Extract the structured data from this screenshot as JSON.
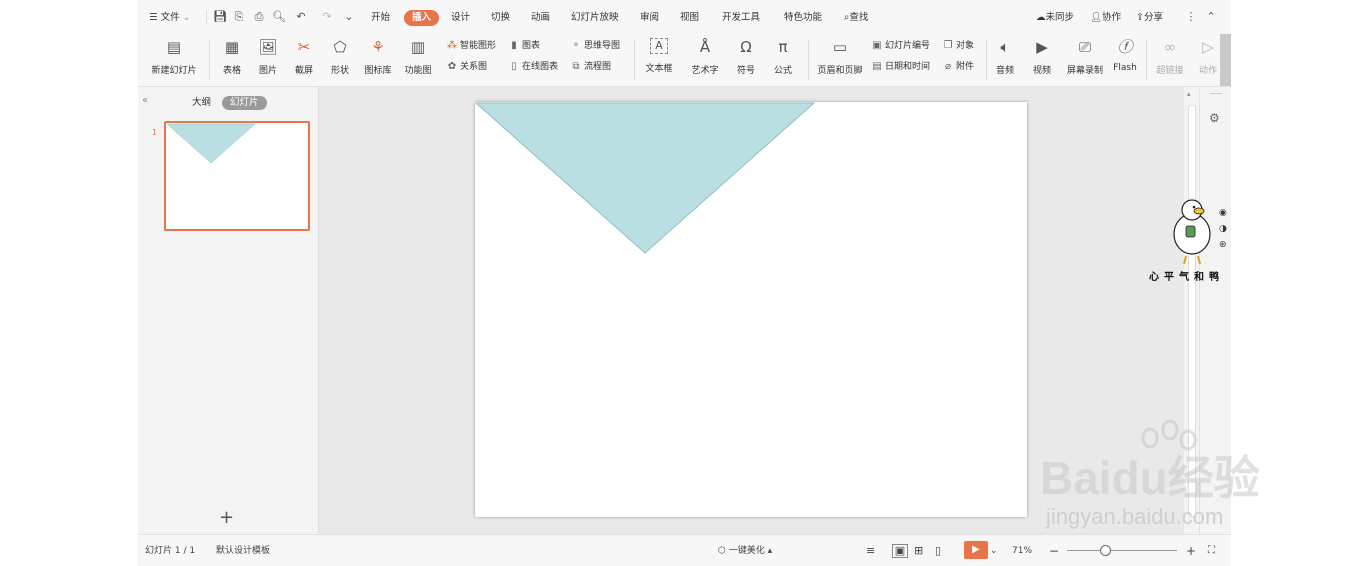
{
  "menubar": {
    "file_label": "文件",
    "tabs": [
      "开始",
      "插入",
      "设计",
      "切换",
      "动画",
      "幻灯片放映",
      "审阅",
      "视图",
      "开发工具",
      "特色功能"
    ],
    "search_label": "查找",
    "sync_label": "未同步",
    "collab_label": "协作",
    "share_label": "分享"
  },
  "ribbon": {
    "new_slide": "新建幻灯片",
    "table": "表格",
    "picture": "图片",
    "screenshot": "截屏",
    "shape": "形状",
    "icon_lib": "图标库",
    "function_chart": "功能图",
    "smart_art": "智能图形",
    "chart": "图表",
    "relation": "关系图",
    "online_chart": "在线图表",
    "mindmap": "思维导图",
    "flowchart": "流程图",
    "textbox": "文本框",
    "wordart": "艺术字",
    "symbol": "符号",
    "formula": "公式",
    "header_footer": "页眉和页脚",
    "slide_number": "幻灯片编号",
    "object": "对象",
    "date_time": "日期和时间",
    "attachment": "附件",
    "audio": "音频",
    "video": "视频",
    "screen_record": "屏幕录制",
    "flash": "Flash",
    "hyperlink": "超链接",
    "action": "动作"
  },
  "leftpanel": {
    "outline_tab": "大纲",
    "slides_tab": "幻灯片",
    "slide_number": "1",
    "add_symbol": "+"
  },
  "status": {
    "slide_count": "幻灯片 1 / 1",
    "template": "默认设计模板",
    "beautify": "一键美化",
    "zoom": "71%"
  },
  "watermark": {
    "sticker_text": "心平气和鸭",
    "baidu_logo": "Baidu经验",
    "url": "jingyan.baidu.com"
  },
  "colors": {
    "accent": "#e8744a",
    "triangle_fill": "#b9dfe2",
    "triangle_stroke": "#8fbec2"
  }
}
